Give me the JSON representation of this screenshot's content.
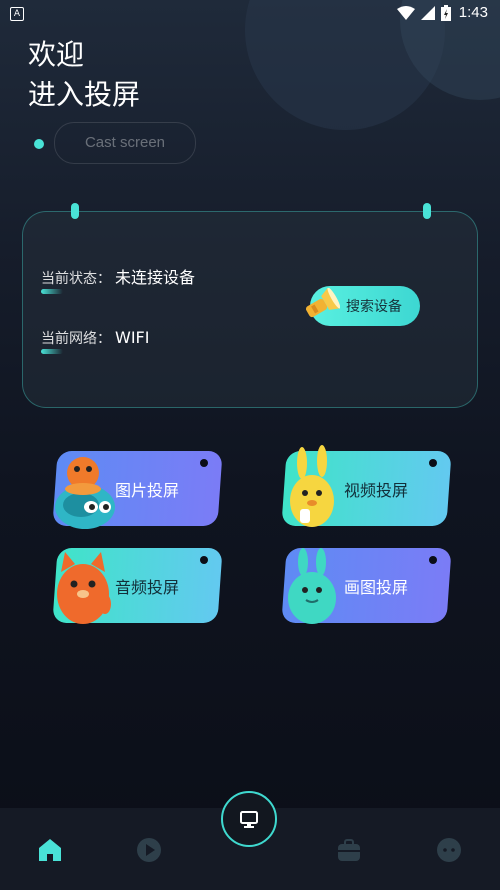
{
  "status_bar": {
    "app_icon_letter": "A",
    "time": "1:43"
  },
  "header": {
    "welcome_line1": "欢迎",
    "welcome_line2": "进入投屏",
    "cast_pill": "Cast screen"
  },
  "status_card": {
    "state_label": "当前状态：",
    "state_value": "未连接设备",
    "network_label": "当前网络：",
    "network_value": "WIFI",
    "search_button": "搜索设备"
  },
  "features": [
    {
      "label": "图片投屏",
      "style": "blue",
      "icon": "orange-bird-mascot-icon"
    },
    {
      "label": "视频投屏",
      "style": "teal",
      "icon": "yellow-bunny-mascot-icon"
    },
    {
      "label": "音频投屏",
      "style": "teal",
      "icon": "orange-cat-mascot-icon"
    },
    {
      "label": "画图投屏",
      "style": "blue",
      "icon": "teal-bunny-mascot-icon"
    }
  ],
  "bottom_nav": {
    "items": [
      "home-icon",
      "play-icon",
      "toolbox-icon",
      "chat-icon"
    ],
    "center": "monitor-icon",
    "active_color": "#49e3d7",
    "inactive_color": "#2e3f4a"
  }
}
